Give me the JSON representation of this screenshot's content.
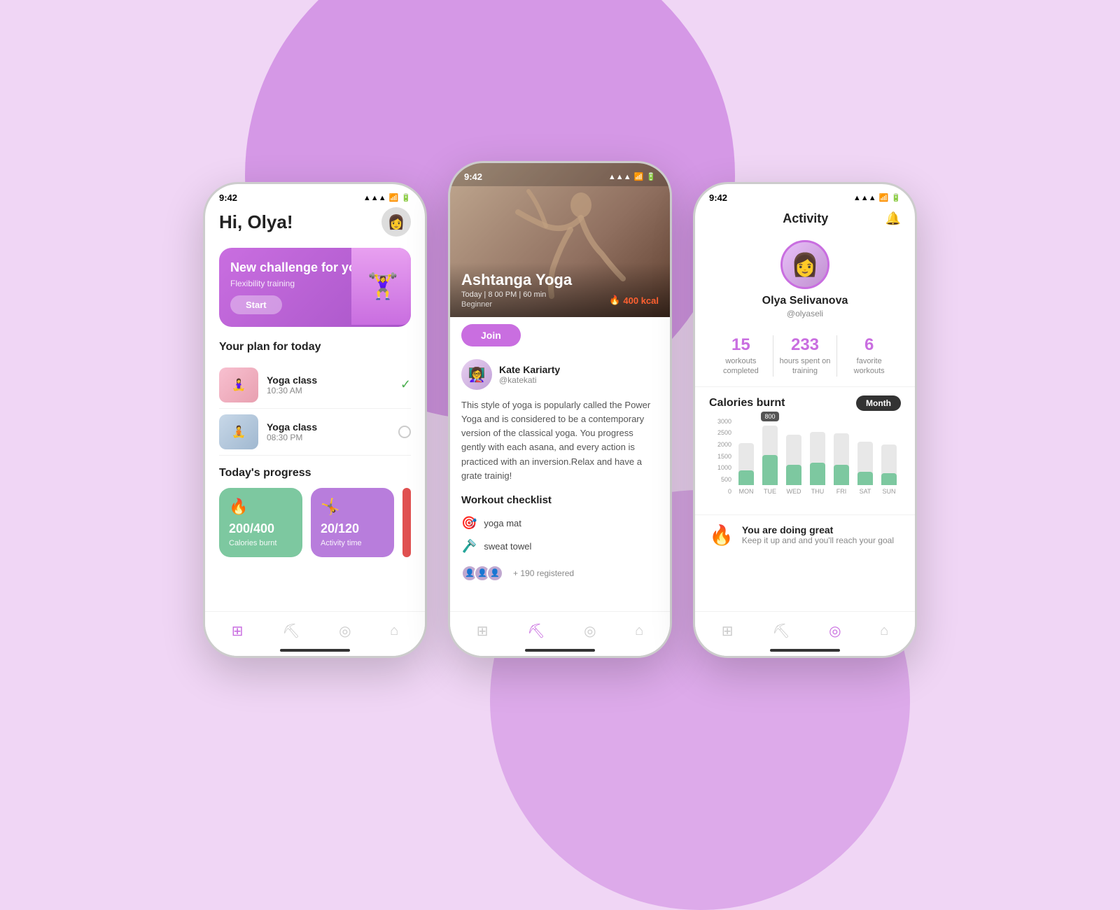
{
  "background": {
    "color": "#f0d6f5"
  },
  "phone1": {
    "status": {
      "time": "9:42",
      "signal": "▲▲▲",
      "wifi": "wifi",
      "battery": "battery"
    },
    "greeting": "Hi, Olya!",
    "challenge_card": {
      "label": "New challenge for you",
      "subtitle": "Flexibility training",
      "button": "Start"
    },
    "plan_title": "Your plan for today",
    "plan_items": [
      {
        "name": "Yoga class",
        "time": "10:30 AM",
        "checked": true,
        "thumb_emoji": "🧘"
      },
      {
        "name": "Yoga class",
        "time": "08:30 PM",
        "checked": false,
        "thumb_emoji": "🧘"
      }
    ],
    "progress_title": "Today's progress",
    "progress_items": [
      {
        "val": "200/400",
        "label": "Calories burnt",
        "icon": "🔥",
        "color": "#7dc8a0"
      },
      {
        "val": "20/120",
        "label": "Activity time",
        "icon": "🤸",
        "color": "#b87ddc"
      }
    ],
    "nav_icons": [
      "⊞",
      "⛏",
      "◎",
      "⌂"
    ]
  },
  "phone2": {
    "status": {
      "time": "9:42"
    },
    "hero": {
      "title": "Ashtanga Yoga",
      "meta": "Today | 8 00 PM | 60 min",
      "level": "Beginner",
      "kcal": "400 kcal"
    },
    "join_button": "Join",
    "instructor": {
      "name": "Kate Kariarty",
      "handle": "@katekati"
    },
    "description": "This style of yoga is popularly called the Power Yoga and is considered to be a contemporary version of the classical yoga.  You progress gently with each asana, and every action is practiced with an inversion.Relax and have a grate trainig!",
    "checklist_title": "Workout checklist",
    "checklist_items": [
      {
        "icon": "🎯",
        "text": "yoga mat"
      },
      {
        "icon": "🪒",
        "text": "sweat towel"
      }
    ],
    "registered": "+ 190 registered",
    "nav_icons": [
      "⊞",
      "⛏",
      "◎",
      "⌂"
    ]
  },
  "phone3": {
    "status": {
      "time": "9:42"
    },
    "activity_title": "Activity",
    "profile": {
      "name": "Olya Selivanova",
      "handle": "@olyaseli"
    },
    "stats": [
      {
        "val": "15",
        "label": "workouts\ncompleted"
      },
      {
        "val": "233",
        "label": "hours spent on\ntraining"
      },
      {
        "val": "6",
        "label": "favorite\nworkouts"
      }
    ],
    "calories_title": "Calories burnt",
    "month_badge": "Month",
    "chart": {
      "y_labels": [
        "3000",
        "2500",
        "2000",
        "1500",
        "1000",
        "500",
        "0"
      ],
      "bars": [
        {
          "day": "MON",
          "height_pct": 55,
          "fill_pct": 30,
          "tooltip": null
        },
        {
          "day": "TUE",
          "height_pct": 85,
          "fill_pct": 45,
          "tooltip": "800"
        },
        {
          "day": "WED",
          "height_pct": 70,
          "fill_pct": 35,
          "tooltip": null
        },
        {
          "day": "THU",
          "height_pct": 75,
          "fill_pct": 38,
          "tooltip": null
        },
        {
          "day": "FRI",
          "height_pct": 72,
          "fill_pct": 36,
          "tooltip": null
        },
        {
          "day": "SAT",
          "height_pct": 60,
          "fill_pct": 28,
          "tooltip": null
        },
        {
          "day": "SUN",
          "height_pct": 55,
          "fill_pct": 25,
          "tooltip": null
        }
      ]
    },
    "motivation": {
      "title": "You are doing great",
      "subtitle": "Keep it up and and you'll reach your goal"
    },
    "nav_icons": [
      "⊞",
      "⛏",
      "◎",
      "⌂"
    ]
  }
}
